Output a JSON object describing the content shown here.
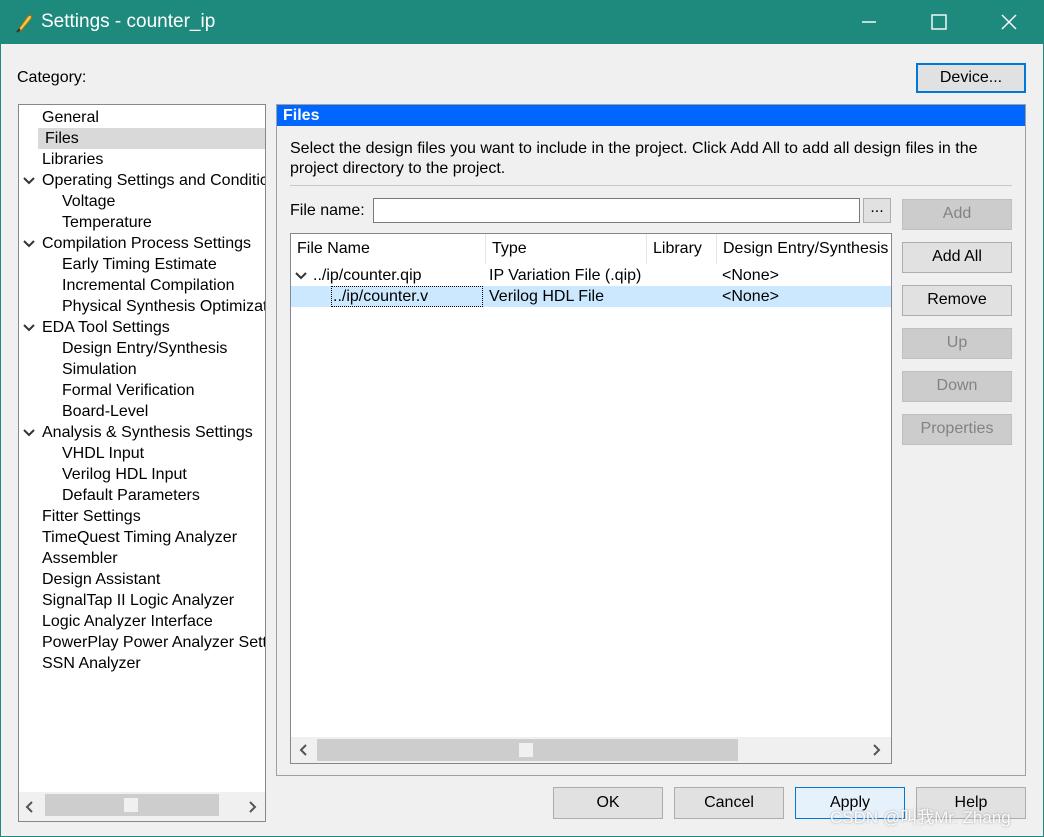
{
  "window": {
    "title": "Settings - counter_ip",
    "app_icon": "quill-pen-icon",
    "controls": [
      "minimize-icon",
      "maximize-icon",
      "close-icon"
    ]
  },
  "category_label": "Category:",
  "device_button": "Device...",
  "tree": [
    {
      "label": "General",
      "level": 0
    },
    {
      "label": "Files",
      "level": 0,
      "selected": true
    },
    {
      "label": "Libraries",
      "level": 0
    },
    {
      "label": "Operating Settings and Conditic",
      "level": 0,
      "expanded": true
    },
    {
      "label": "Voltage",
      "level": 1
    },
    {
      "label": "Temperature",
      "level": 1
    },
    {
      "label": "Compilation Process Settings",
      "level": 0,
      "expanded": true
    },
    {
      "label": "Early Timing Estimate",
      "level": 1
    },
    {
      "label": "Incremental Compilation",
      "level": 1
    },
    {
      "label": "Physical Synthesis Optimizati",
      "level": 1
    },
    {
      "label": "EDA Tool Settings",
      "level": 0,
      "expanded": true
    },
    {
      "label": "Design Entry/Synthesis",
      "level": 1
    },
    {
      "label": "Simulation",
      "level": 1
    },
    {
      "label": "Formal Verification",
      "level": 1
    },
    {
      "label": "Board-Level",
      "level": 1
    },
    {
      "label": "Analysis & Synthesis Settings",
      "level": 0,
      "expanded": true
    },
    {
      "label": "VHDL Input",
      "level": 1
    },
    {
      "label": "Verilog HDL Input",
      "level": 1
    },
    {
      "label": "Default Parameters",
      "level": 1
    },
    {
      "label": "Fitter Settings",
      "level": 0
    },
    {
      "label": "TimeQuest Timing Analyzer",
      "level": 0
    },
    {
      "label": "Assembler",
      "level": 0
    },
    {
      "label": "Design Assistant",
      "level": 0
    },
    {
      "label": "SignalTap II Logic Analyzer",
      "level": 0
    },
    {
      "label": "Logic Analyzer Interface",
      "level": 0
    },
    {
      "label": "PowerPlay Power Analyzer Setti",
      "level": 0
    },
    {
      "label": "SSN Analyzer",
      "level": 0
    }
  ],
  "files_panel": {
    "heading": "Files",
    "description_line1": "Select the design files you want to include in the project. Click Add All to add all design files in the",
    "description_line2": "project directory to the project.",
    "file_name_label": "File name:",
    "file_name_value": "",
    "browse_label": "...",
    "columns": [
      "File Name",
      "Type",
      "Library",
      "Design Entry/Synthesis T"
    ],
    "rows": [
      {
        "file": "../ip/counter.qip",
        "type": "IP Variation File (.qip)",
        "library": "",
        "design_entry": "<None>",
        "expanded": true
      },
      {
        "file": "../ip/counter.v",
        "type": "Verilog HDL File",
        "library": "",
        "design_entry": "<None>",
        "selected": true
      }
    ],
    "side_buttons": [
      {
        "label": "Add",
        "enabled": false
      },
      {
        "label": "Add All",
        "enabled": true
      },
      {
        "label": "Remove",
        "enabled": true
      },
      {
        "label": "Up",
        "enabled": false
      },
      {
        "label": "Down",
        "enabled": false
      },
      {
        "label": "Properties",
        "enabled": false
      }
    ]
  },
  "footer_buttons": {
    "ok": "OK",
    "cancel": "Cancel",
    "apply": "Apply",
    "help": "Help"
  },
  "watermark": "CSDN @叫我Mr. Zhang",
  "colors": {
    "titlebar": "#1e8a7e",
    "panel_header": "#0066ff",
    "selected_row": "#cce8ff",
    "tree_selected": "#d9d9d9"
  }
}
